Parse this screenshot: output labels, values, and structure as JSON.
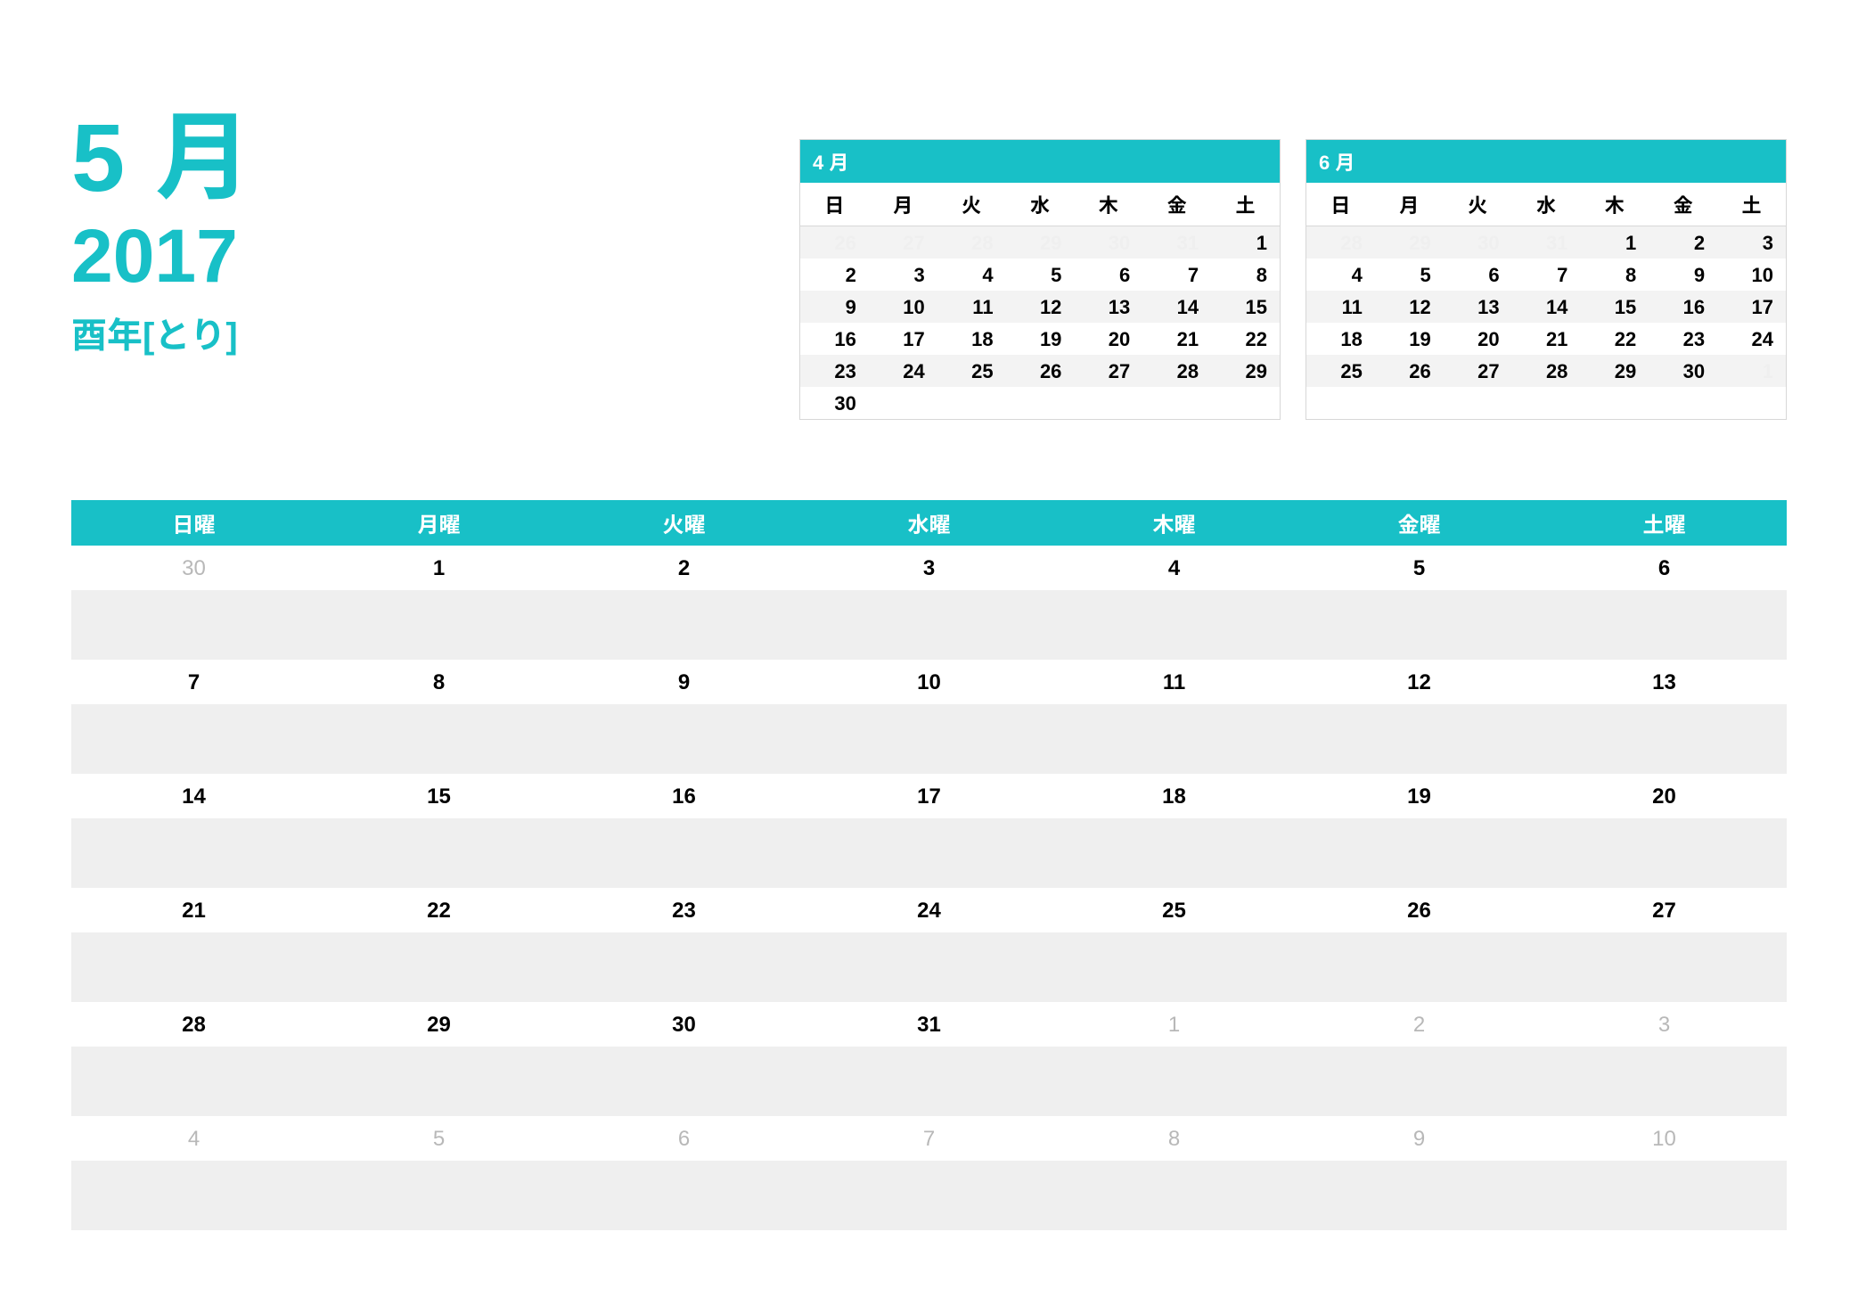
{
  "title": {
    "month": "5 月",
    "year": "2017",
    "zodiac": "酉年[とり]"
  },
  "mini": {
    "dow": [
      "日",
      "月",
      "火",
      "水",
      "木",
      "金",
      "土"
    ],
    "prev": {
      "label": "4 月",
      "weeks": [
        [
          {
            "d": "26",
            "off": true
          },
          {
            "d": "27",
            "off": true
          },
          {
            "d": "28",
            "off": true
          },
          {
            "d": "29",
            "off": true
          },
          {
            "d": "30",
            "off": true
          },
          {
            "d": "31",
            "off": true
          },
          {
            "d": "1"
          }
        ],
        [
          {
            "d": "2"
          },
          {
            "d": "3"
          },
          {
            "d": "4"
          },
          {
            "d": "5"
          },
          {
            "d": "6"
          },
          {
            "d": "7"
          },
          {
            "d": "8"
          }
        ],
        [
          {
            "d": "9"
          },
          {
            "d": "10"
          },
          {
            "d": "11"
          },
          {
            "d": "12"
          },
          {
            "d": "13"
          },
          {
            "d": "14"
          },
          {
            "d": "15"
          }
        ],
        [
          {
            "d": "16"
          },
          {
            "d": "17"
          },
          {
            "d": "18"
          },
          {
            "d": "19"
          },
          {
            "d": "20"
          },
          {
            "d": "21"
          },
          {
            "d": "22"
          }
        ],
        [
          {
            "d": "23"
          },
          {
            "d": "24"
          },
          {
            "d": "25"
          },
          {
            "d": "26"
          },
          {
            "d": "27"
          },
          {
            "d": "28"
          },
          {
            "d": "29"
          }
        ],
        [
          {
            "d": "30"
          },
          {
            "d": ""
          },
          {
            "d": ""
          },
          {
            "d": ""
          },
          {
            "d": ""
          },
          {
            "d": ""
          },
          {
            "d": ""
          }
        ]
      ]
    },
    "next": {
      "label": "6 月",
      "weeks": [
        [
          {
            "d": "28",
            "off": true
          },
          {
            "d": "29",
            "off": true
          },
          {
            "d": "30",
            "off": true
          },
          {
            "d": "31",
            "off": true
          },
          {
            "d": "1"
          },
          {
            "d": "2"
          },
          {
            "d": "3"
          }
        ],
        [
          {
            "d": "4"
          },
          {
            "d": "5"
          },
          {
            "d": "6"
          },
          {
            "d": "7"
          },
          {
            "d": "8"
          },
          {
            "d": "9"
          },
          {
            "d": "10"
          }
        ],
        [
          {
            "d": "11"
          },
          {
            "d": "12"
          },
          {
            "d": "13"
          },
          {
            "d": "14"
          },
          {
            "d": "15"
          },
          {
            "d": "16"
          },
          {
            "d": "17"
          }
        ],
        [
          {
            "d": "18"
          },
          {
            "d": "19"
          },
          {
            "d": "20"
          },
          {
            "d": "21"
          },
          {
            "d": "22"
          },
          {
            "d": "23"
          },
          {
            "d": "24"
          }
        ],
        [
          {
            "d": "25"
          },
          {
            "d": "26"
          },
          {
            "d": "27"
          },
          {
            "d": "28"
          },
          {
            "d": "29"
          },
          {
            "d": "30"
          },
          {
            "d": "1",
            "off": true
          }
        ],
        [
          {
            "d": ""
          },
          {
            "d": ""
          },
          {
            "d": ""
          },
          {
            "d": ""
          },
          {
            "d": ""
          },
          {
            "d": ""
          },
          {
            "d": ""
          }
        ]
      ]
    }
  },
  "main": {
    "dow": [
      "日曜",
      "月曜",
      "火曜",
      "水曜",
      "木曜",
      "金曜",
      "土曜"
    ],
    "weeks": [
      [
        {
          "d": "30",
          "off": true
        },
        {
          "d": "1"
        },
        {
          "d": "2"
        },
        {
          "d": "3"
        },
        {
          "d": "4"
        },
        {
          "d": "5"
        },
        {
          "d": "6"
        }
      ],
      [
        {
          "d": "7"
        },
        {
          "d": "8"
        },
        {
          "d": "9"
        },
        {
          "d": "10"
        },
        {
          "d": "11"
        },
        {
          "d": "12"
        },
        {
          "d": "13"
        }
      ],
      [
        {
          "d": "14"
        },
        {
          "d": "15"
        },
        {
          "d": "16"
        },
        {
          "d": "17"
        },
        {
          "d": "18"
        },
        {
          "d": "19"
        },
        {
          "d": "20"
        }
      ],
      [
        {
          "d": "21"
        },
        {
          "d": "22"
        },
        {
          "d": "23"
        },
        {
          "d": "24"
        },
        {
          "d": "25"
        },
        {
          "d": "26"
        },
        {
          "d": "27"
        }
      ],
      [
        {
          "d": "28"
        },
        {
          "d": "29"
        },
        {
          "d": "30"
        },
        {
          "d": "31"
        },
        {
          "d": "1",
          "off": true
        },
        {
          "d": "2",
          "off": true
        },
        {
          "d": "3",
          "off": true
        }
      ],
      [
        {
          "d": "4",
          "off": true
        },
        {
          "d": "5",
          "off": true
        },
        {
          "d": "6",
          "off": true
        },
        {
          "d": "7",
          "off": true
        },
        {
          "d": "8",
          "off": true
        },
        {
          "d": "9",
          "off": true
        },
        {
          "d": "10",
          "off": true
        }
      ]
    ]
  }
}
